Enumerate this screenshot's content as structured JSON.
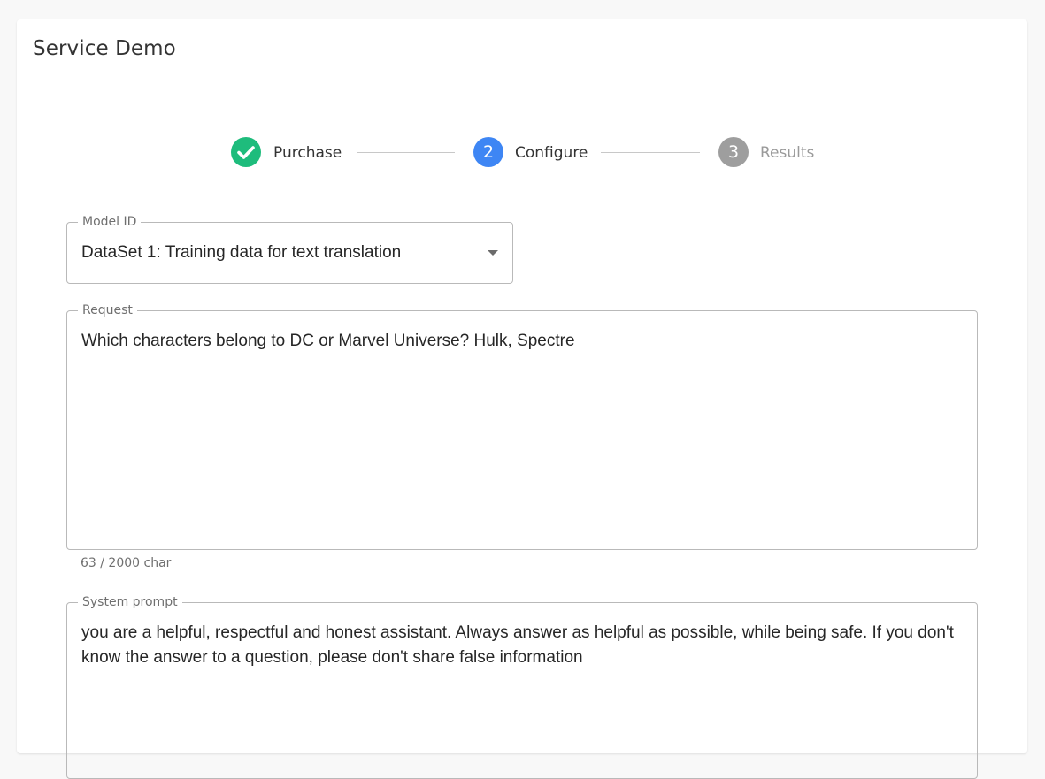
{
  "card": {
    "title": "Service Demo"
  },
  "stepper": {
    "steps": [
      {
        "number": "",
        "label": "Purchase",
        "state": "completed",
        "icon": "check-icon"
      },
      {
        "number": "2",
        "label": "Configure",
        "state": "active"
      },
      {
        "number": "3",
        "label": "Results",
        "state": "pending"
      }
    ]
  },
  "form": {
    "model": {
      "label": "Model ID",
      "value": "DataSet 1: Training data for text translation"
    },
    "request": {
      "label": "Request",
      "value": "Which characters belong to DC or Marvel Universe? Hulk, Spectre",
      "counter": "63 / 2000 char"
    },
    "system_prompt": {
      "label": "System prompt",
      "value": "you are a helpful, respectful and honest assistant. Always answer as helpful as possible, while being safe. If you don't know the answer to a question, please don't share false information"
    }
  },
  "colors": {
    "completed": "#1ebc7c",
    "active": "#3e86f4",
    "pending": "#9e9e9e",
    "label_active": "#333333",
    "label_pending": "#9a9a9a"
  }
}
